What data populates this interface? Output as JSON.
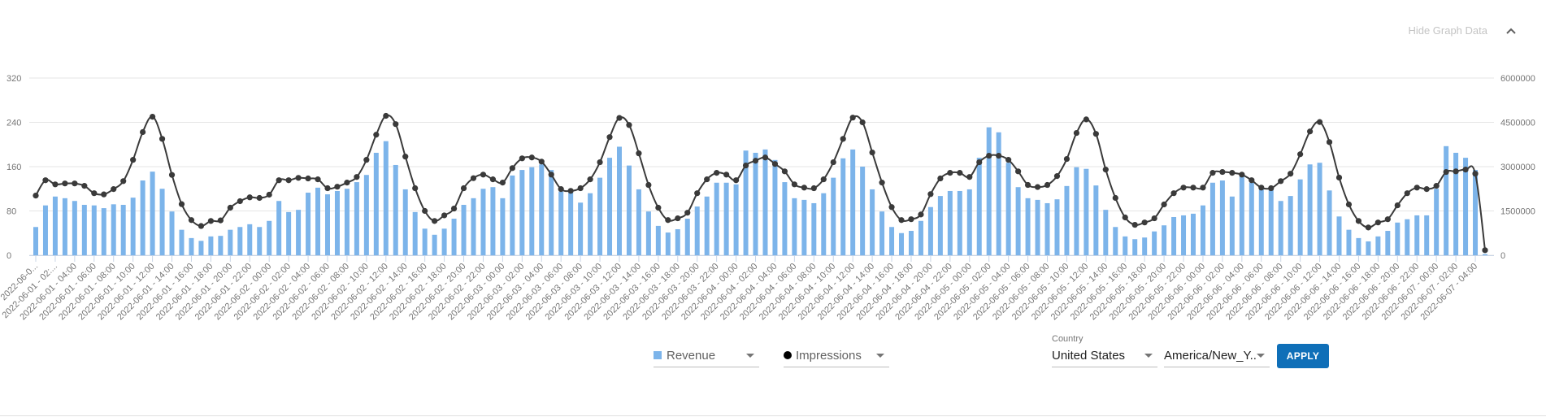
{
  "header": {
    "toggle_label": "Hide Graph Data",
    "toggle_icon": "chevron-up-icon"
  },
  "colors": {
    "revenue_bar": "#7cb4ea",
    "impressions_line": "#3a3a3a",
    "apply_button": "#0f6fb8"
  },
  "controls": {
    "metric1": {
      "label": "Revenue",
      "icon": "square-legend-icon"
    },
    "metric2": {
      "label": "Impressions",
      "icon": "dot-legend-icon"
    },
    "country": {
      "label": "Country",
      "value": "United States"
    },
    "timezone": {
      "value": "America/New_Y..."
    },
    "apply_label": "APPLY"
  },
  "chart_data": {
    "type": "bar",
    "title": "",
    "xlabel": "",
    "ylabel": "Revenue",
    "y2label": "Impressions",
    "ylim": [
      0,
      320
    ],
    "y2lim": [
      0,
      6000000
    ],
    "yticks": [
      "0",
      "80",
      "160",
      "240",
      "320"
    ],
    "y2ticks": [
      "0",
      "1500000",
      "3000000",
      "4500000",
      "6000000"
    ],
    "grid": true,
    "start": "2022-06-01 00:00",
    "interval_hours": 1,
    "label_every": 2,
    "xtick_labels": [
      "2022-06-0...",
      "2022-06-01 - 02:...",
      "2022-06-01 - 04:00",
      "2022-06-01 - 06:00",
      "2022-06-01 - 08:00",
      "2022-06-01 - 10:00",
      "2022-06-01 - 12:00",
      "2022-06-01 - 14:00",
      "2022-06-01 - 16:00",
      "2022-06-01 - 18:00",
      "2022-06-01 - 20:00",
      "2022-06-01 - 22:00",
      "2022-06-02 - 00:00",
      "2022-06-02 - 02:00",
      "2022-06-02 - 04:00",
      "2022-06-02 - 06:00",
      "2022-06-02 - 08:00",
      "2022-06-02 - 10:00",
      "2022-06-02 - 12:00",
      "2022-06-02 - 14:00",
      "2022-06-02 - 16:00",
      "2022-06-02 - 18:00",
      "2022-06-02 - 20:00",
      "2022-06-02 - 22:00",
      "2022-06-03 - 00:00",
      "2022-06-03 - 02:00",
      "2022-06-03 - 04:00",
      "2022-06-03 - 06:00",
      "2022-06-03 - 08:00",
      "2022-06-03 - 10:00",
      "2022-06-03 - 12:00",
      "2022-06-03 - 14:00",
      "2022-06-03 - 16:00",
      "2022-06-03 - 18:00",
      "2022-06-03 - 20:00",
      "2022-06-03 - 22:00",
      "2022-06-04 - 00:00",
      "2022-06-04 - 02:00",
      "2022-06-04 - 04:00",
      "2022-06-04 - 06:00",
      "2022-06-04 - 08:00",
      "2022-06-04 - 10:00",
      "2022-06-04 - 12:00",
      "2022-06-04 - 14:00",
      "2022-06-04 - 16:00",
      "2022-06-04 - 18:00",
      "2022-06-04 - 20:00",
      "2022-06-04 - 22:00",
      "2022-06-05 - 00:00",
      "2022-06-05 - 02:00",
      "2022-06-05 - 04:00",
      "2022-06-05 - 06:00",
      "2022-06-05 - 08:00",
      "2022-06-05 - 10:00",
      "2022-06-05 - 12:00",
      "2022-06-05 - 14:00",
      "2022-06-05 - 16:00",
      "2022-06-05 - 18:00",
      "2022-06-05 - 20:00",
      "2022-06-05 - 22:00",
      "2022-06-06 - 00:00",
      "2022-06-06 - 02:00",
      "2022-06-06 - 04:00",
      "2022-06-06 - 06:00",
      "2022-06-06 - 08:00",
      "2022-06-06 - 10:00",
      "2022-06-06 - 12:00",
      "2022-06-06 - 14:00",
      "2022-06-06 - 16:00",
      "2022-06-06 - 18:00",
      "2022-06-06 - 20:00",
      "2022-06-06 - 22:00",
      "2022-06-07 - 00:00",
      "2022-06-07 - 02:00",
      "2022-06-07 - 04:00"
    ],
    "legend": [
      "Revenue",
      "Impressions"
    ],
    "series": [
      {
        "name": "Revenue",
        "type": "bar",
        "axis": "left",
        "values": [
          51,
          90,
          106,
          103,
          98,
          91,
          90,
          85,
          92,
          91,
          104,
          135,
          151,
          120,
          79,
          46,
          31,
          26,
          34,
          35,
          46,
          51,
          56,
          51,
          62,
          98,
          78,
          82,
          113,
          122,
          110,
          116,
          120,
          132,
          145,
          185,
          206,
          163,
          119,
          78,
          48,
          37,
          48,
          66,
          91,
          103,
          120,
          123,
          103,
          144,
          154,
          159,
          164,
          154,
          115,
          113,
          95,
          112,
          140,
          176,
          196,
          162,
          119,
          79,
          53,
          41,
          47,
          66,
          88,
          106,
          131,
          131,
          128,
          189,
          185,
          191,
          172,
          132,
          103,
          100,
          94,
          112,
          140,
          175,
          191,
          160,
          119,
          79,
          51,
          40,
          44,
          62,
          87,
          107,
          116,
          116,
          119,
          176,
          231,
          222,
          167,
          123,
          103,
          100,
          94,
          101,
          125,
          159,
          156,
          126,
          82,
          51,
          34,
          29,
          32,
          43,
          54,
          69,
          72,
          75,
          90,
          131,
          135,
          106,
          144,
          131,
          119,
          119,
          98,
          107,
          137,
          164,
          167,
          117,
          70,
          46,
          31,
          25,
          34,
          44,
          59,
          65,
          72,
          72,
          120,
          197,
          185,
          176,
          154,
          2
        ]
      },
      {
        "name": "Impressions",
        "type": "line",
        "axis": "right",
        "values": [
          2020000,
          2540000,
          2400000,
          2430000,
          2430000,
          2350000,
          2100000,
          2060000,
          2240000,
          2510000,
          3230000,
          4170000,
          4690000,
          3940000,
          2720000,
          1730000,
          1190000,
          990000,
          1160000,
          1180000,
          1610000,
          1830000,
          1960000,
          1940000,
          2050000,
          2540000,
          2540000,
          2620000,
          2600000,
          2570000,
          2270000,
          2320000,
          2460000,
          2650000,
          3230000,
          4080000,
          4720000,
          4440000,
          3340000,
          2270000,
          1500000,
          1160000,
          1350000,
          1580000,
          2270000,
          2610000,
          2730000,
          2570000,
          2460000,
          2950000,
          3280000,
          3310000,
          3170000,
          2730000,
          2240000,
          2180000,
          2270000,
          2570000,
          3150000,
          4000000,
          4650000,
          4410000,
          3450000,
          2380000,
          1610000,
          1190000,
          1250000,
          1440000,
          2100000,
          2570000,
          2790000,
          2730000,
          2540000,
          3040000,
          3200000,
          3310000,
          3090000,
          2840000,
          2400000,
          2290000,
          2270000,
          2570000,
          3150000,
          3940000,
          4660000,
          4500000,
          3480000,
          2460000,
          1630000,
          1190000,
          1220000,
          1380000,
          2070000,
          2600000,
          2790000,
          2790000,
          2650000,
          3150000,
          3370000,
          3370000,
          3230000,
          2840000,
          2380000,
          2310000,
          2380000,
          2680000,
          3260000,
          4140000,
          4600000,
          4110000,
          2900000,
          1940000,
          1280000,
          1030000,
          1110000,
          1250000,
          1720000,
          2100000,
          2290000,
          2290000,
          2290000,
          2790000,
          2820000,
          2790000,
          2730000,
          2540000,
          2290000,
          2270000,
          2510000,
          2760000,
          3420000,
          4190000,
          4510000,
          3830000,
          2630000,
          1720000,
          1160000,
          940000,
          1110000,
          1220000,
          1690000,
          2100000,
          2290000,
          2240000,
          2350000,
          2820000,
          2840000,
          2900000,
          2760000,
          170000
        ]
      }
    ]
  }
}
